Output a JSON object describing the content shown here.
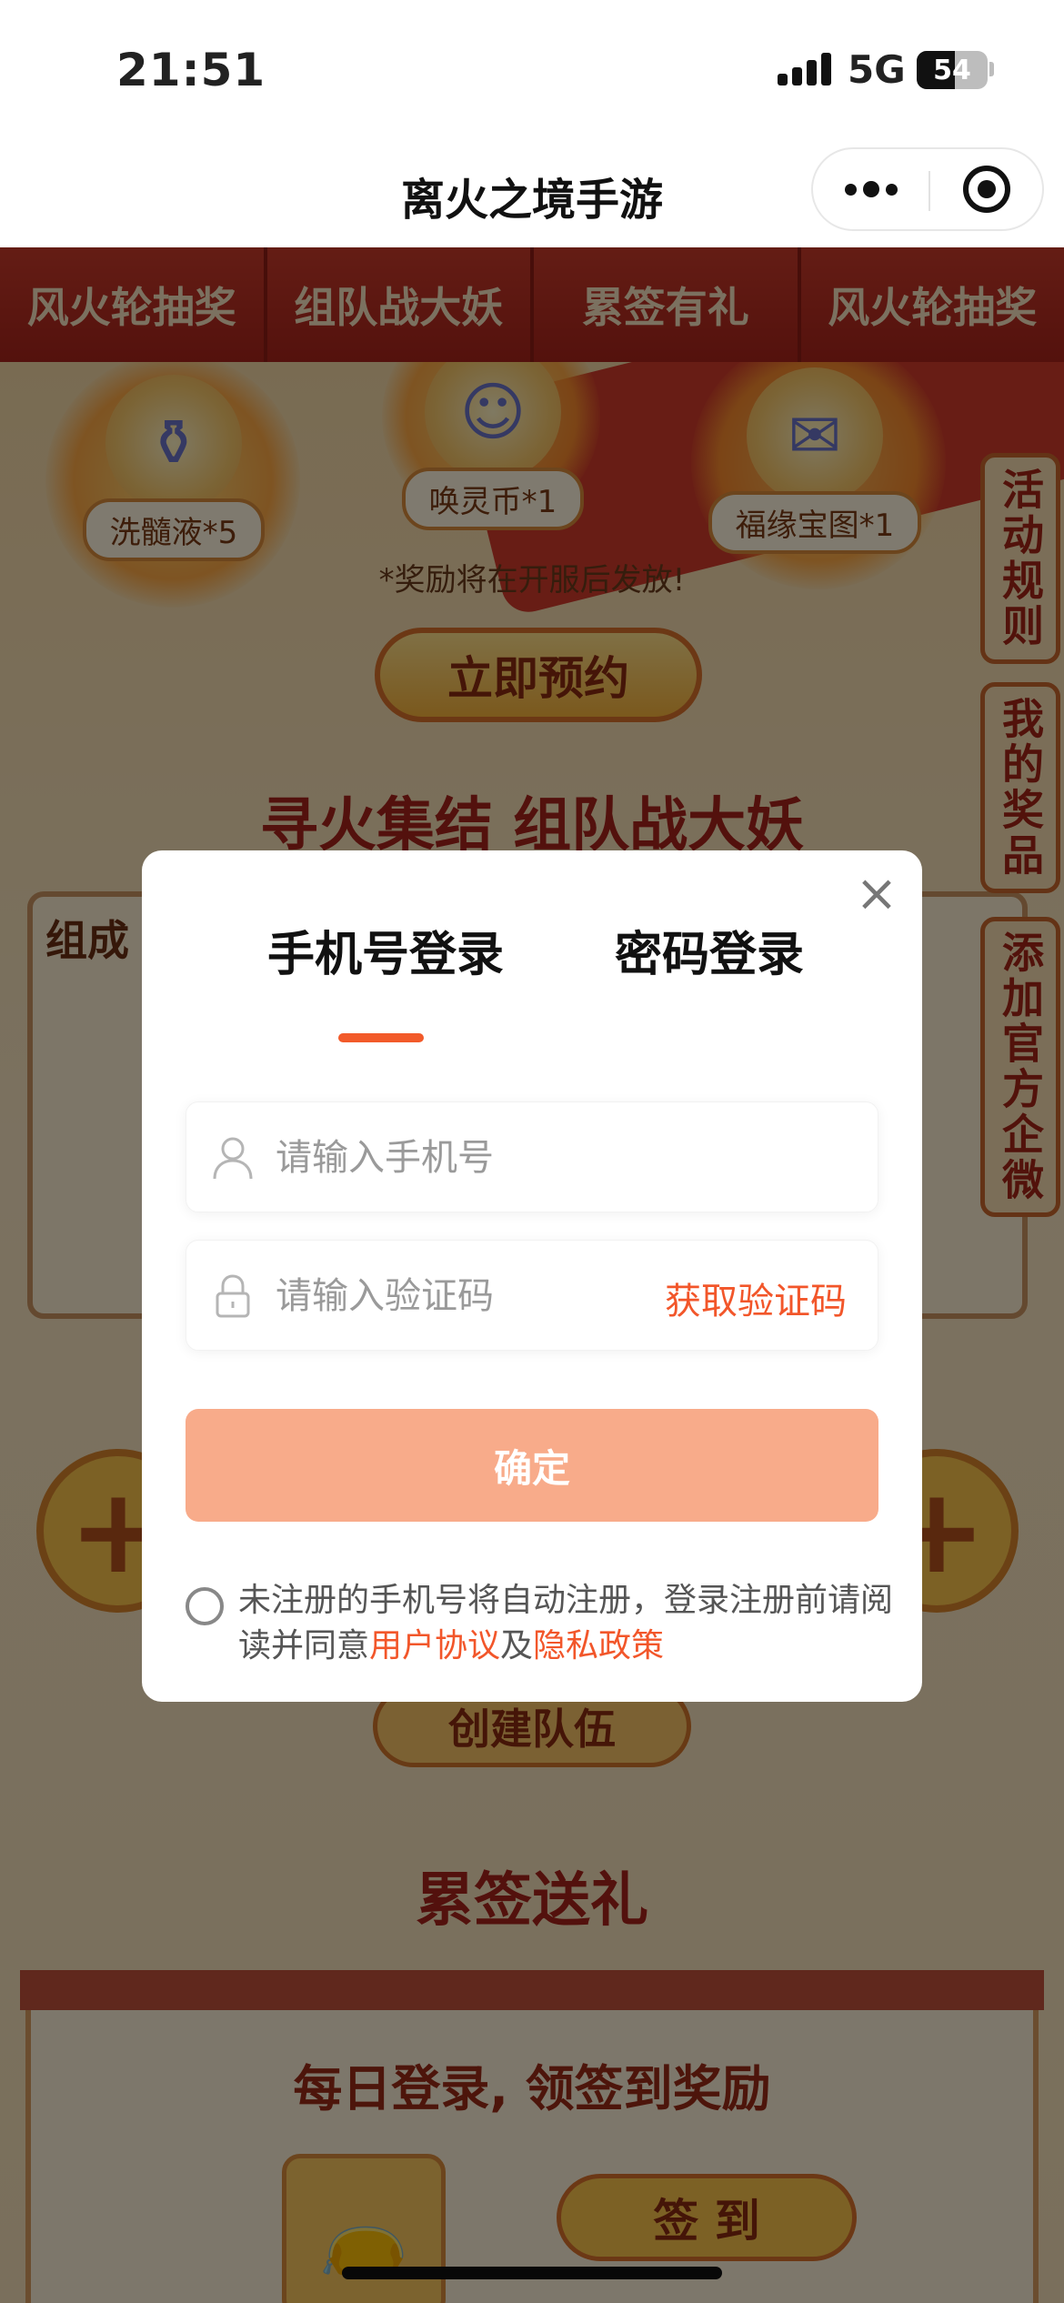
{
  "status_bar": {
    "time": "21:51",
    "network": "5G",
    "battery": "54",
    "battery_level": 0.54
  },
  "nav": {
    "title": "离火之境手游",
    "more_icon": "more-dots-icon",
    "close_icon": "mini-program-close-icon"
  },
  "tabs": [
    "风火轮抽奖",
    "组队战大妖",
    "累签有礼",
    "风火轮抽奖"
  ],
  "background": {
    "rewards": [
      {
        "label": "洗髓液*5",
        "icon": "potion-icon"
      },
      {
        "label": "唤灵币*1",
        "icon": "coin-icon"
      },
      {
        "label": "福缘宝图*1",
        "icon": "map-scroll-icon"
      }
    ],
    "notice": "*奖励将在开服后发放!",
    "reserve_button": "立即预约",
    "section_team_title": "寻火集结 组队战大妖",
    "team_card_label": "组成",
    "create_team_button": "创建队伍",
    "section_signin_title": "累签送礼",
    "signin_subtitle": "每日登录, 领签到奖励",
    "signin_button": "签 到",
    "side_buttons": [
      "活动规则",
      "我的奖品",
      "添加官方企微"
    ]
  },
  "modal": {
    "tab_phone": "手机号登录",
    "tab_password": "密码登录",
    "phone_placeholder": "请输入手机号",
    "code_placeholder": "请输入验证码",
    "get_code": "获取验证码",
    "confirm": "确定",
    "agreement_prefix": "未注册的手机号将自动注册，登录注册前请阅读并同意",
    "user_agreement": "用户协议",
    "and": "及",
    "privacy_policy": "隐私政策",
    "close_icon": "close-icon"
  },
  "colors": {
    "accent": "#f2562a",
    "confirm_bg": "#f8ab8a",
    "tab_strip": "#b62a1f"
  }
}
